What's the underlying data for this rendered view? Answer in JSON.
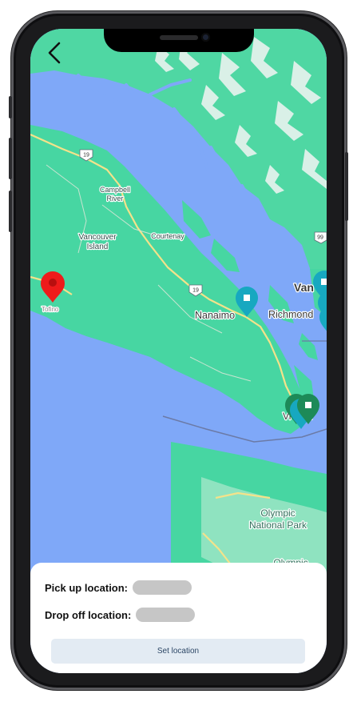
{
  "map": {
    "labels": {
      "campbell_river_1": "Campbell",
      "campbell_river_2": "River",
      "vancouver_island_1": "Vancouver",
      "vancouver_island_2": "Island",
      "courtenay": "Courtenay",
      "nanaimo": "Nanaimo",
      "richmond": "Richmond",
      "vancouver_partial": "Van",
      "victoria_partial": "Vi     ia",
      "tofino": "Tofino",
      "olympic_np_1": "Olympic",
      "olympic_np_2": "National Park",
      "olympic_partial": "Olympic"
    },
    "shields": {
      "hwy19_a": "19",
      "hwy19_b": "19",
      "hwy99": "99"
    },
    "colors": {
      "water": "#7fa8f8",
      "land": "#47d6a2",
      "road": "#f5e6a0",
      "pin_red": "#ee1b1b",
      "pin_teal": "#17a8c0",
      "pin_green": "#1d8a58"
    }
  },
  "sheet": {
    "pickup_label": "Pick up location:",
    "dropoff_label": "Drop off location:",
    "set_button": "Set location"
  },
  "icons": {
    "back": "chevron-left-icon"
  }
}
